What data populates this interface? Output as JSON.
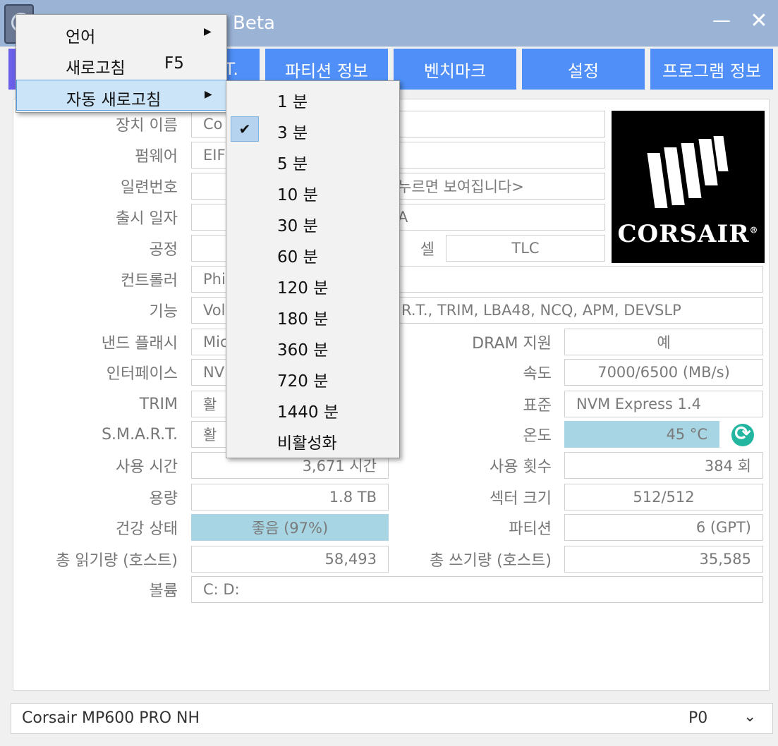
{
  "window": {
    "title": "Beta",
    "minimize_glyph": "—",
    "close_glyph": "✕"
  },
  "tabs": [
    {
      "label": "T."
    },
    {
      "label": "파티션 정보"
    },
    {
      "label": "벤치마크"
    },
    {
      "label": "설정"
    },
    {
      "label": "프로그램 정보"
    }
  ],
  "fields": {
    "device_name": {
      "label": "장치 이름",
      "value": "Co"
    },
    "firmware": {
      "label": "펌웨어",
      "value": "EIF"
    },
    "serial": {
      "label": "일련번호",
      "value": "누르면 보여집니다>"
    },
    "release_date": {
      "label": "출시 일자",
      "value": "A"
    },
    "process": {
      "label": "공정",
      "value": ""
    },
    "cell": {
      "label": "셀",
      "value": "TLC"
    },
    "controller": {
      "label": "컨트롤러",
      "value": "Phi"
    },
    "features": {
      "label": "기능",
      "value": "Vol",
      "value_tail": "R.T., TRIM, LBA48, NCQ, APM, DEVSLP"
    },
    "nand": {
      "label": "낸드 플래시",
      "value": "Mic"
    },
    "dram": {
      "label": "DRAM 지원",
      "value": "예"
    },
    "interface": {
      "label": "인터페이스",
      "value": "NV"
    },
    "speed": {
      "label": "속도",
      "value": "7000/6500 (MB/s)"
    },
    "trim": {
      "label": "TRIM",
      "value": "활"
    },
    "standard": {
      "label": "표준",
      "value": "NVM Express 1.4"
    },
    "smart": {
      "label": "S.M.A.R.T.",
      "value": "활"
    },
    "temperature": {
      "label": "온도",
      "value": "45 °C"
    },
    "power_on_hours": {
      "label": "사용 시간",
      "value": "3,671 시간"
    },
    "power_cycles": {
      "label": "사용 횟수",
      "value": "384 회"
    },
    "capacity": {
      "label": "용량",
      "value": "1.8 TB"
    },
    "sector_size": {
      "label": "섹터 크기",
      "value": "512/512"
    },
    "health": {
      "label": "건강 상태",
      "value": "좋음 (97%)"
    },
    "partition": {
      "label": "파티션",
      "value": "6 (GPT)"
    },
    "host_reads": {
      "label": "총 읽기량 (호스트)",
      "value": "58,493"
    },
    "host_writes": {
      "label": "총 쓰기량 (호스트)",
      "value": "35,585"
    },
    "volume": {
      "label": "볼륨",
      "value": "C: D:"
    }
  },
  "logo": {
    "brand": "CORSAIR",
    "mark": "®"
  },
  "drive_select": {
    "name": "Corsair MP600 PRO NH",
    "port": "P0",
    "chevron": "⌄"
  },
  "menu": {
    "items": [
      {
        "label": "언어",
        "arrow": "▶"
      },
      {
        "label": "새로고침",
        "shortcut": "F5"
      },
      {
        "label": "자동 새로고침",
        "arrow": "▶"
      }
    ]
  },
  "submenu": {
    "checked_index": 1,
    "check_glyph": "✔",
    "items": [
      {
        "label": "1 분"
      },
      {
        "label": "3 분"
      },
      {
        "label": "5 분"
      },
      {
        "label": "10 분"
      },
      {
        "label": "30 분"
      },
      {
        "label": "60 분"
      },
      {
        "label": "120 분"
      },
      {
        "label": "180 분"
      },
      {
        "label": "360 분"
      },
      {
        "label": "720 분"
      },
      {
        "label": "1440 분"
      },
      {
        "label": "비활성화"
      }
    ]
  }
}
